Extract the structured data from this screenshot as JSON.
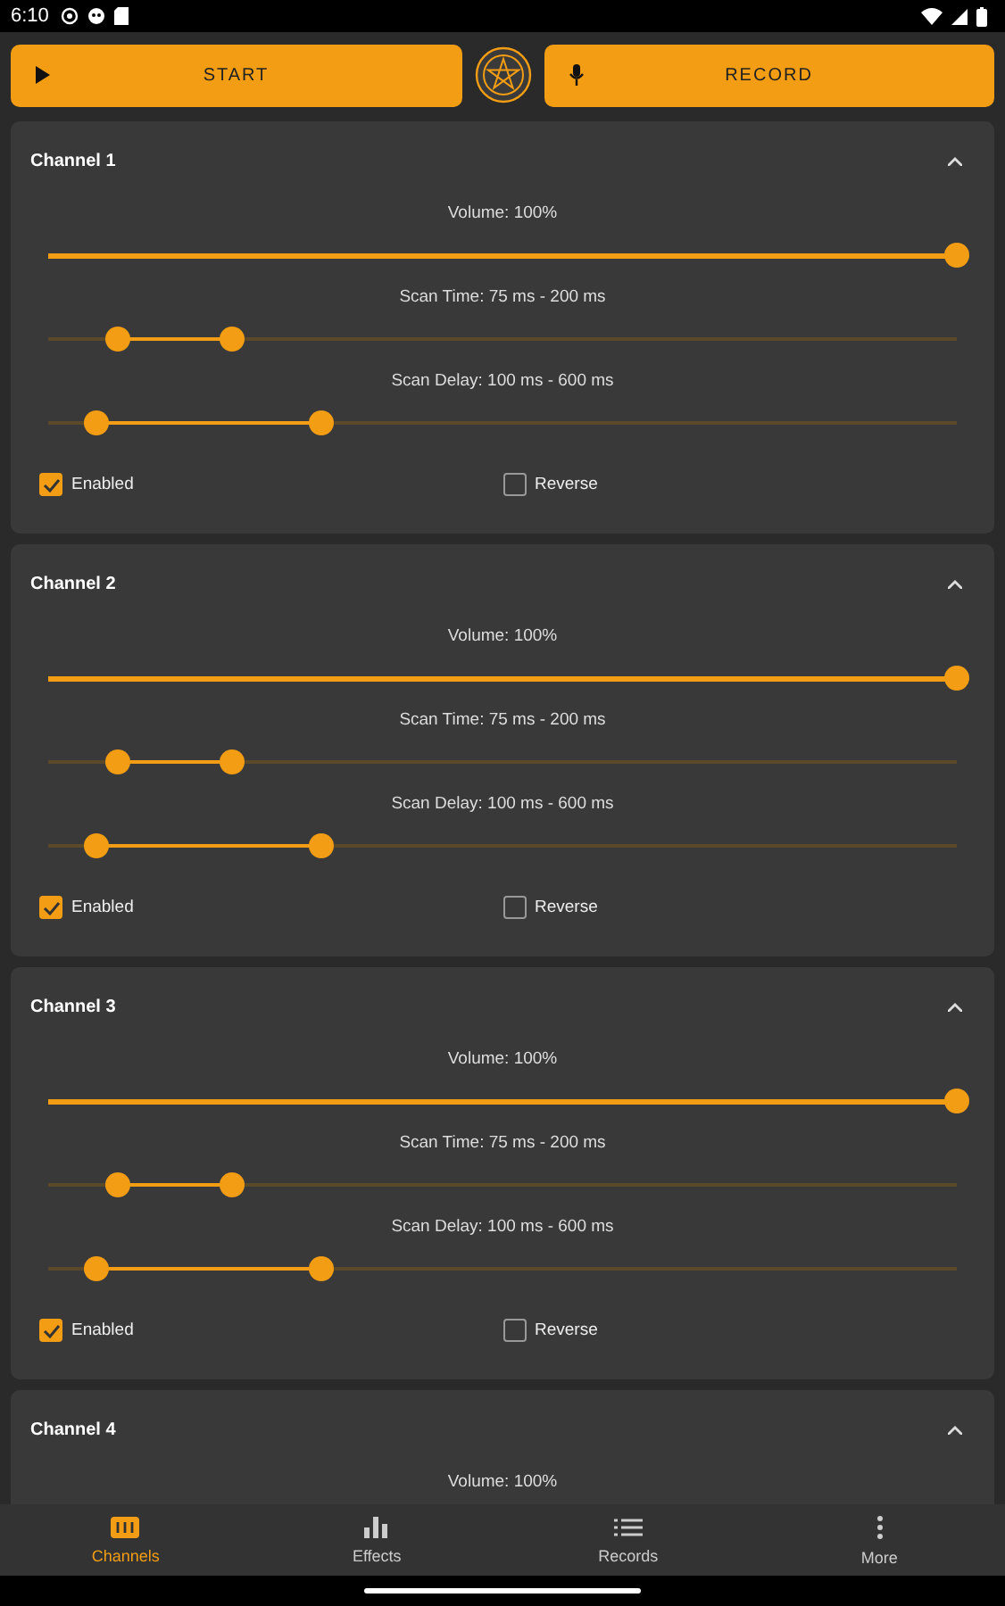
{
  "status_bar": {
    "time": "6:10"
  },
  "actions": [
    {
      "kind": "play",
      "label": "START"
    },
    {
      "kind": "logo"
    },
    {
      "kind": "mic",
      "label": "RECORD"
    }
  ],
  "channels": [
    {
      "name": "Channel 1",
      "expanded": true,
      "volume": {
        "label": "Volume: 100%",
        "level": 1
      },
      "scan_time": {
        "label": "Scan Time: 75 ms - 200 ms",
        "thumbs": [
          {
            "level": 0.077
          },
          {
            "level": 0.203
          }
        ]
      },
      "scan_delay": {
        "label": "Scan Delay: 100 ms - 600 ms",
        "thumbs": [
          {
            "level": 0.053
          },
          {
            "level": 0.3
          }
        ]
      },
      "options": [
        {
          "label": "Enabled",
          "checked": true
        },
        {
          "label": "Reverse",
          "checked": false
        }
      ]
    },
    {
      "name": "Channel 2",
      "expanded": true,
      "volume": {
        "label": "Volume: 100%",
        "level": 1
      },
      "scan_time": {
        "label": "Scan Time: 75 ms - 200 ms",
        "thumbs": [
          {
            "level": 0.077
          },
          {
            "level": 0.203
          }
        ]
      },
      "scan_delay": {
        "label": "Scan Delay: 100 ms - 600 ms",
        "thumbs": [
          {
            "level": 0.053
          },
          {
            "level": 0.3
          }
        ]
      },
      "options": [
        {
          "label": "Enabled",
          "checked": true
        },
        {
          "label": "Reverse",
          "checked": false
        }
      ]
    },
    {
      "name": "Channel 3",
      "expanded": true,
      "volume": {
        "label": "Volume: 100%",
        "level": 1
      },
      "scan_time": {
        "label": "Scan Time: 75 ms - 200 ms",
        "thumbs": [
          {
            "level": 0.077
          },
          {
            "level": 0.203
          }
        ]
      },
      "scan_delay": {
        "label": "Scan Delay: 100 ms - 600 ms",
        "thumbs": [
          {
            "level": 0.053
          },
          {
            "level": 0.3
          }
        ]
      },
      "options": [
        {
          "label": "Enabled",
          "checked": true
        },
        {
          "label": "Reverse",
          "checked": false
        }
      ]
    },
    {
      "name": "Channel 4",
      "expanded": true,
      "volume": {
        "label": "Volume: 100%"
      }
    }
  ],
  "bottom_nav": [
    {
      "kind": "channels",
      "label": "Channels",
      "selected": true
    },
    {
      "kind": "effects",
      "label": "Effects",
      "selected": false
    },
    {
      "kind": "records",
      "label": "Records",
      "selected": false
    },
    {
      "kind": "more",
      "label": "More",
      "selected": false
    }
  ]
}
